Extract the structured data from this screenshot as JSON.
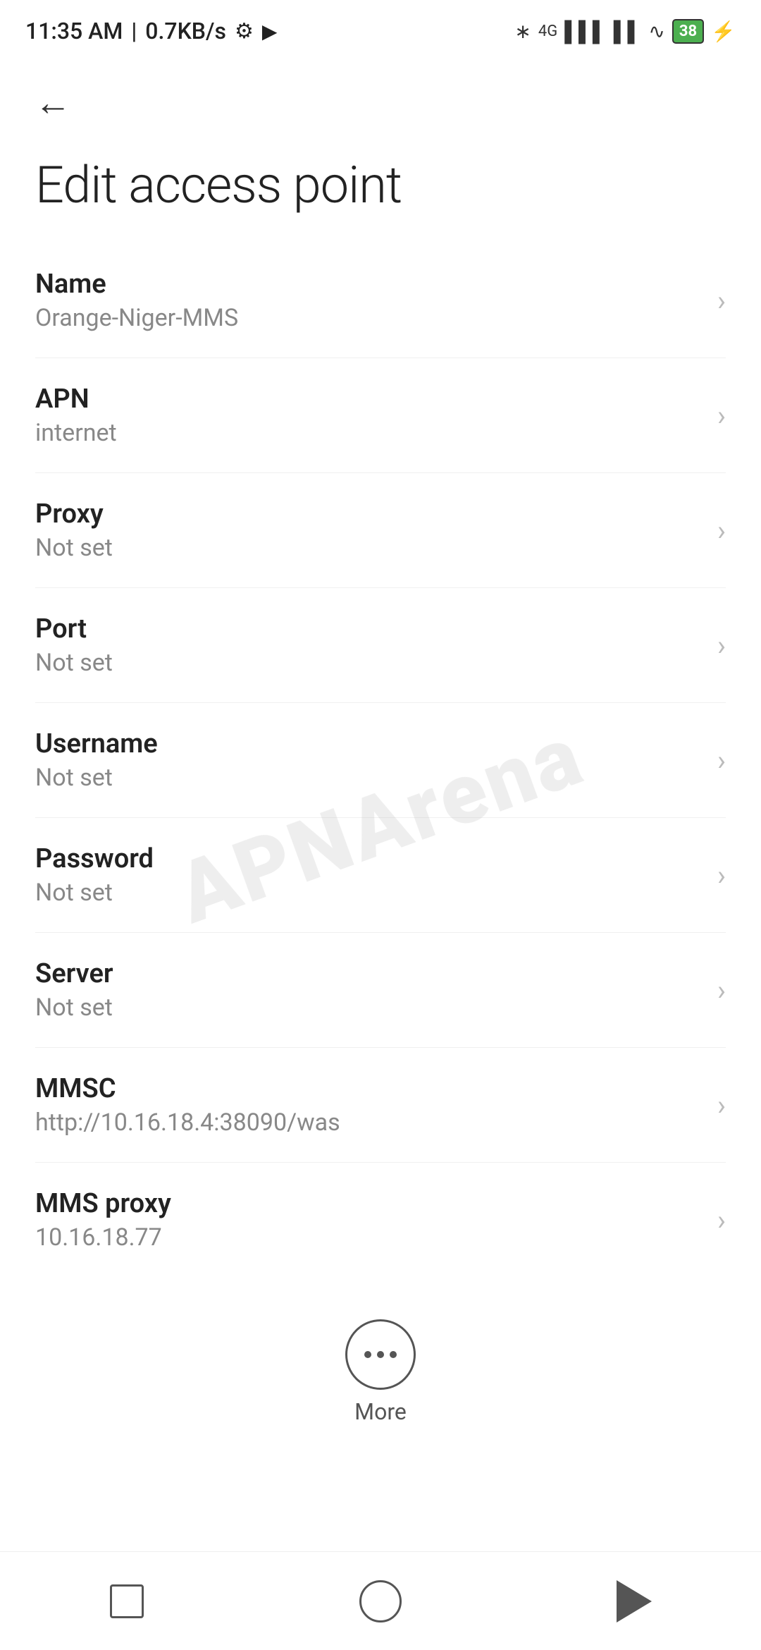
{
  "statusBar": {
    "time": "11:35 AM",
    "speed": "0.7KB/s",
    "battery": "38"
  },
  "navigation": {
    "backLabel": "←"
  },
  "page": {
    "title": "Edit access point"
  },
  "settings": [
    {
      "label": "Name",
      "value": "Orange-Niger-MMS"
    },
    {
      "label": "APN",
      "value": "internet"
    },
    {
      "label": "Proxy",
      "value": "Not set"
    },
    {
      "label": "Port",
      "value": "Not set"
    },
    {
      "label": "Username",
      "value": "Not set"
    },
    {
      "label": "Password",
      "value": "Not set"
    },
    {
      "label": "Server",
      "value": "Not set"
    },
    {
      "label": "MMSC",
      "value": "http://10.16.18.4:38090/was"
    },
    {
      "label": "MMS proxy",
      "value": "10.16.18.77"
    }
  ],
  "more": {
    "label": "More"
  },
  "watermark": {
    "text": "APNArena"
  }
}
